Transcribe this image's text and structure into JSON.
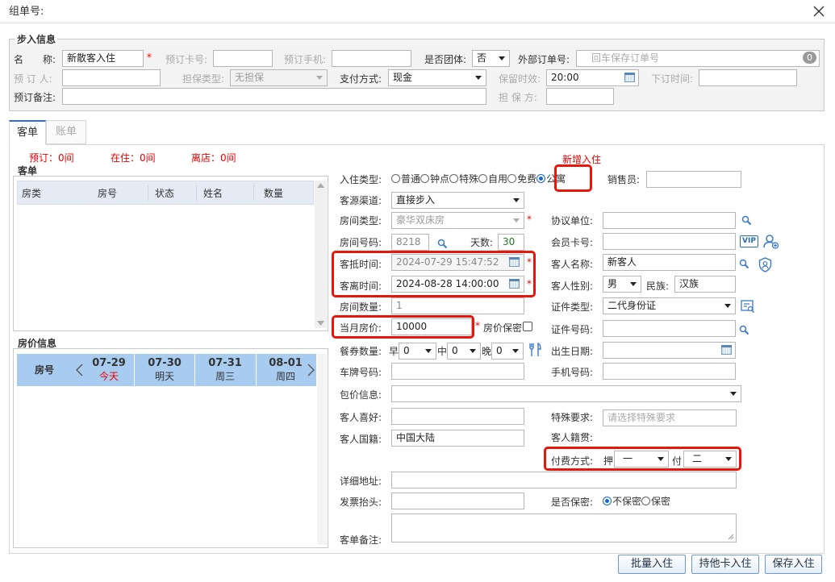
{
  "dialog": {
    "title": "组单号:"
  },
  "walkin": {
    "section_title": "步入信息",
    "name_label": "名　　称:",
    "name_value": "新散客入住",
    "card_label": "预订卡号:",
    "phone_label": "预订手机:",
    "group_label": "是否团体:",
    "group_value": "否",
    "ext_order_label": "外部订单号:",
    "ext_order_placeholder": "回车保存订单号",
    "ext_badge": "0",
    "booker_label": "预 订 人:",
    "guarantee_type_label": "担保类型:",
    "guarantee_type_value": "无担保",
    "pay_label": "支付方式:",
    "pay_value": "现金",
    "hold_label": "保留时效:",
    "hold_value": "20:00",
    "order_time_label": "下订时间:",
    "remark_label": "预订备注:",
    "guarantor_label": "担 保 方:"
  },
  "tabs": [
    "客单",
    "账单"
  ],
  "stats": {
    "booked": "预订：0间",
    "in_house": "在住：0间",
    "leaving": "离店：0间"
  },
  "guest_list": {
    "title": "客单",
    "columns": [
      "房类",
      "房号",
      "状态",
      "姓名",
      "数量"
    ]
  },
  "price_info": {
    "title": "房价信息",
    "room_label": "房号",
    "days": [
      {
        "date": "07-29",
        "day": "今天"
      },
      {
        "date": "07-30",
        "day": "明天"
      },
      {
        "date": "07-31",
        "day": "周三"
      },
      {
        "date": "08-01",
        "day": "周四"
      }
    ]
  },
  "form": {
    "new_checkin_tag": "新增入住",
    "checkin_type_label": "入住类型:",
    "checkin_types": [
      "普通",
      "钟点",
      "特殊",
      "自用",
      "免费",
      "公寓"
    ],
    "checkin_type_selected": "公寓",
    "sales_label": "销售员:",
    "source_label": "客源渠道:",
    "source_value": "直接步入",
    "room_type_label": "房间类型:",
    "room_type_value": "豪华双床房",
    "agreement_label": "协议单位:",
    "room_no_label": "房间号码:",
    "room_no_value": "8218",
    "days_label": "天数:",
    "days_value": "30",
    "member_label": "会员卡号:",
    "vip_badge": "VIP",
    "arrive_label": "客抵时间:",
    "arrive_value": "2024-07-29 15:47:52",
    "guest_name_label": "客人名称:",
    "guest_name_value": "新客人",
    "depart_label": "客离时间:",
    "depart_value": "2024-08-28 14:00:00",
    "gender_label": "客人性别:",
    "gender_value": "男",
    "ethnic_label": "民族:",
    "ethnic_value": "汉族",
    "room_count_label": "房间数量:",
    "room_count_value": "1",
    "id_type_label": "证件类型:",
    "id_type_value": "二代身份证",
    "price_label": "当月房价:",
    "price_value": "10000",
    "price_secret_label": "房价保密",
    "id_no_label": "证件号码:",
    "meal_label": "餐券数量:",
    "breakfast_label": "早",
    "breakfast_value": "0",
    "lunch_label": "中",
    "lunch_value": "0",
    "dinner_label": "晚",
    "dinner_value": "0",
    "birth_label": "出生日期:",
    "plate_label": "车牌号码:",
    "mobile_label": "手机号码:",
    "package_label": "包价信息:",
    "hobby_label": "客人喜好:",
    "special_label": "特殊要求:",
    "special_placeholder": "请选择特殊要求",
    "nationality_label": "客人国籍:",
    "nationality_value": "中国大陆",
    "origin_label": "客人籍贯:",
    "payment_label": "付费方式:",
    "deposit_label": "押",
    "deposit_value": "一",
    "pay_cycle_label": "付",
    "pay_cycle_value": "二",
    "address_label": "详细地址:",
    "invoice_label": "发票抬头:",
    "secret_label": "是否保密:",
    "secret_options": [
      "不保密",
      "保密"
    ],
    "secret_selected": "不保密",
    "remark_label": "客单备注:"
  },
  "buttons": {
    "batch": "批量入住",
    "other_card": "持他卡入住",
    "save": "保存入住"
  }
}
